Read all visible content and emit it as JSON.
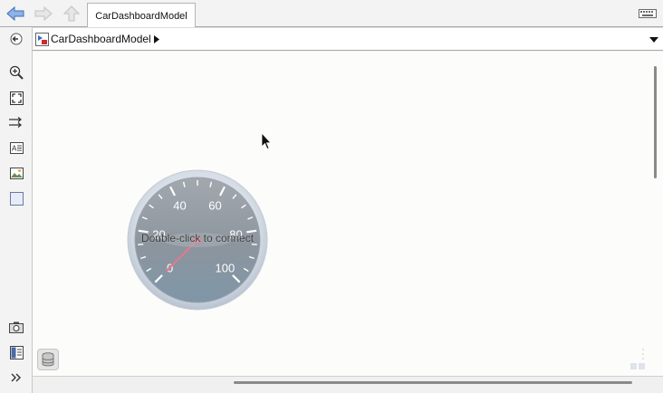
{
  "toolbar": {
    "back_icon": "back-arrow-icon",
    "forward_icon": "forward-arrow-icon",
    "up_icon": "up-arrow-icon",
    "tab_label": "CarDashboardModel",
    "keyboard_icon": "keyboard-icon"
  },
  "address": {
    "label": "CarDashboardModel",
    "model_icon": "simulink-model-icon",
    "dropdown_icon": "chevron-down-icon"
  },
  "palette": {
    "items": [
      {
        "name": "hide-show-browser",
        "icon": "hide-browser-icon"
      },
      {
        "name": "zoom-in",
        "icon": "zoom-in-icon"
      },
      {
        "name": "fit-to-view",
        "icon": "fit-to-view-icon"
      },
      {
        "name": "signal-routing",
        "icon": "arrows-icon"
      },
      {
        "name": "annotation",
        "icon": "text-annotation-icon"
      },
      {
        "name": "image",
        "icon": "image-icon"
      },
      {
        "name": "area",
        "icon": "area-icon"
      },
      {
        "name": "screenshot",
        "icon": "camera-icon"
      },
      {
        "name": "explorer-bar",
        "icon": "explorer-icon"
      },
      {
        "name": "expand",
        "icon": "double-chevron-right-icon"
      }
    ]
  },
  "gauge": {
    "caption": "Double-click to connect",
    "tick_labels": [
      "0",
      "20",
      "40",
      "60",
      "80",
      "100"
    ],
    "min": 0,
    "max": 100,
    "needle_value": 0
  },
  "canvas": {
    "database_icon": "database-icon"
  },
  "colors": {
    "accent_blue": "#4a78c8",
    "gauge_face": "#8a939c",
    "needle": "#e07a8c"
  }
}
